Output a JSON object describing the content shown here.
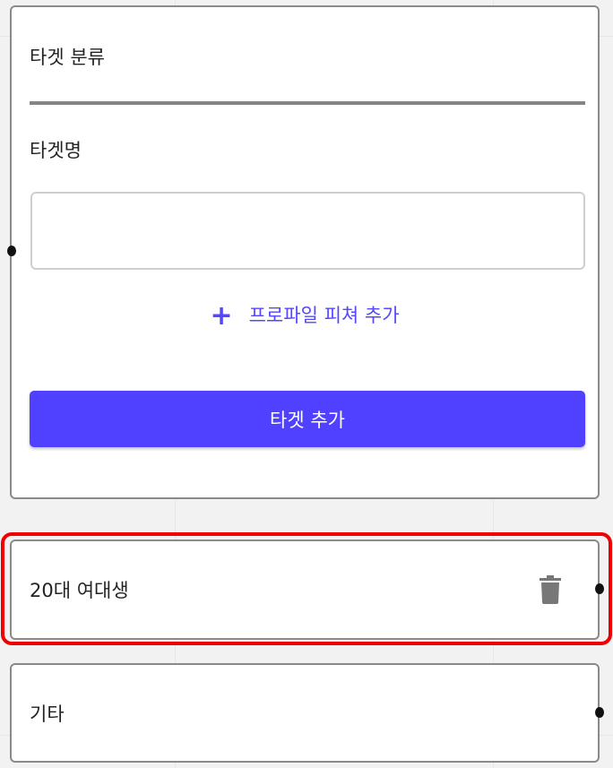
{
  "form": {
    "category_label": "타겟 분류",
    "name_label": "타겟명",
    "name_input_value": "",
    "add_feature_label": "프로파일 피쳐 추가",
    "add_target_button": "타겟 추가"
  },
  "targets": [
    {
      "name": "20대 여대생",
      "icon": "trash-icon",
      "highlighted": true
    },
    {
      "name": "기타"
    }
  ],
  "colors": {
    "accent": "#5040ff",
    "highlight": "#ee0000"
  }
}
